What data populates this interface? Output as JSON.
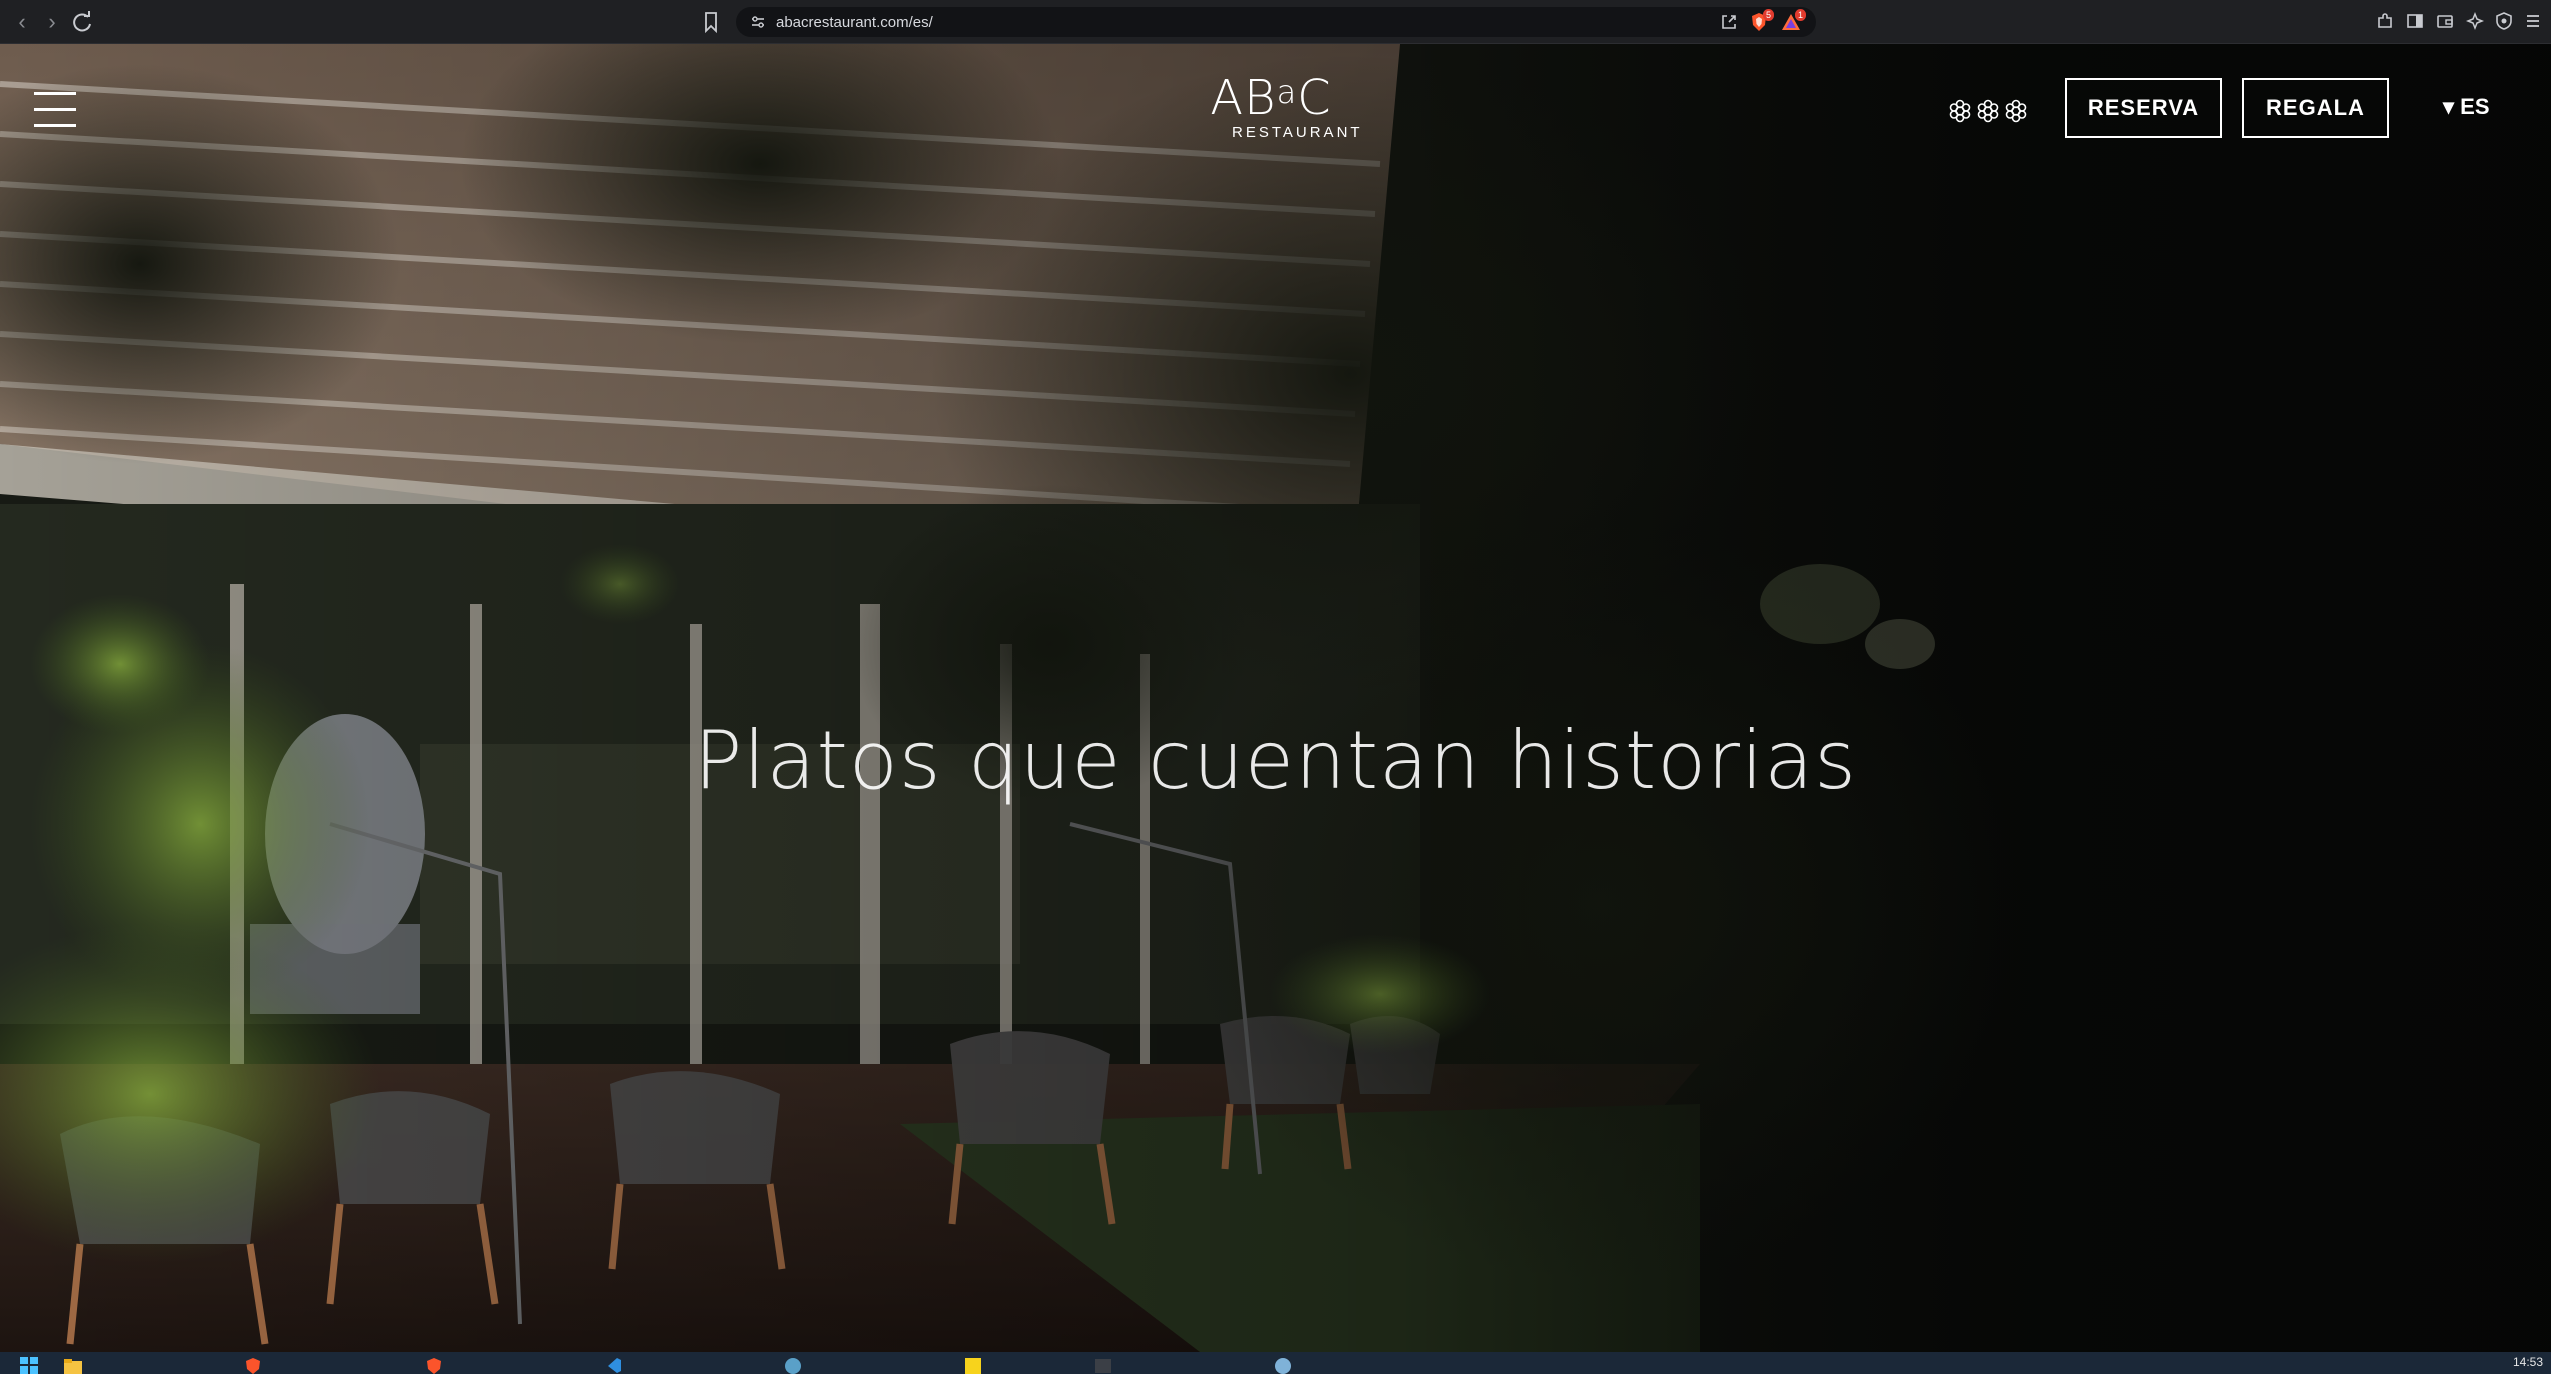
{
  "browser": {
    "url": "abacrestaurant.com/es/",
    "shield_badge": "5",
    "rewards_badge": "1"
  },
  "site": {
    "logo": {
      "main": "ABaC",
      "main_prefix": "AB",
      "main_super": "a",
      "main_suffix": "C",
      "sub": "RESTAURANT"
    },
    "stars_icon": "michelin-stars-icon",
    "reserve_label": "RESERVA",
    "gift_label": "REGALA",
    "language": "▾ ES",
    "hero_title": "Platos que cuentan historias"
  },
  "taskbar": {
    "clock": "14:53"
  },
  "colors": {
    "chrome_bg": "#1f2023",
    "urlbar_bg": "#121316",
    "taskbar_bg": "#1b2838",
    "text": "#ffffff"
  }
}
